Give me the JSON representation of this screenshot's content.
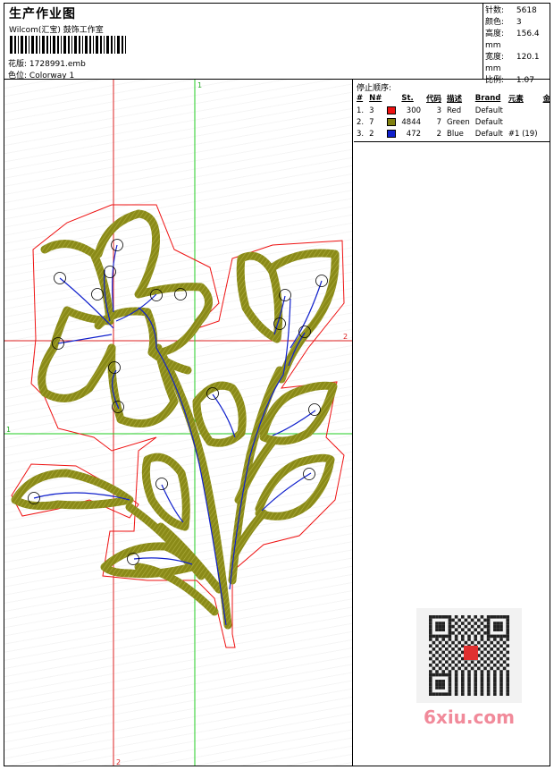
{
  "header": {
    "title": "生产作业图",
    "brand": "Wilcom(汇宝) 鼓饰工作室",
    "design_label": "花版:",
    "design_file": "1728991.emb",
    "colorway_label": "色位:",
    "colorway": "Colorway 1"
  },
  "stats": [
    {
      "label": "针数:",
      "value": "5618"
    },
    {
      "label": "颜色:",
      "value": "3"
    },
    {
      "label": "高度:",
      "value": "156.4 mm"
    },
    {
      "label": "宽度:",
      "value": "120.1 mm"
    },
    {
      "label": "比例:",
      "value": "1.07"
    }
  ],
  "stop_sequence": {
    "title": "停止顺序:",
    "headers": [
      "#",
      "N#",
      "St.",
      "代码",
      "描述",
      "Brand",
      "元素",
      "金片机"
    ],
    "rows": [
      {
        "num": "1.",
        "n": "3",
        "color": "#ee1111",
        "stitches": "300",
        "code": "3",
        "desc": "Red",
        "brand": "Default",
        "element": "",
        "sequin": ""
      },
      {
        "num": "2.",
        "n": "7",
        "color": "#808010",
        "stitches": "4844",
        "code": "7",
        "desc": "Green",
        "brand": "Default",
        "element": "",
        "sequin": ""
      },
      {
        "num": "3.",
        "n": "2",
        "color": "#1020cc",
        "stitches": "472",
        "code": "2",
        "desc": "Blue",
        "brand": "Default",
        "element": "#1 (19)",
        "sequin": ""
      }
    ]
  },
  "guides": {
    "label_1": "1",
    "label_2": "2"
  },
  "colors": {
    "outline": "#ee1111",
    "fill": "#8a8a18",
    "path": "#1020cc",
    "guide_red": "#dd2222",
    "guide_green": "#22cc22"
  },
  "watermark": {
    "text": "6xiu.com"
  }
}
